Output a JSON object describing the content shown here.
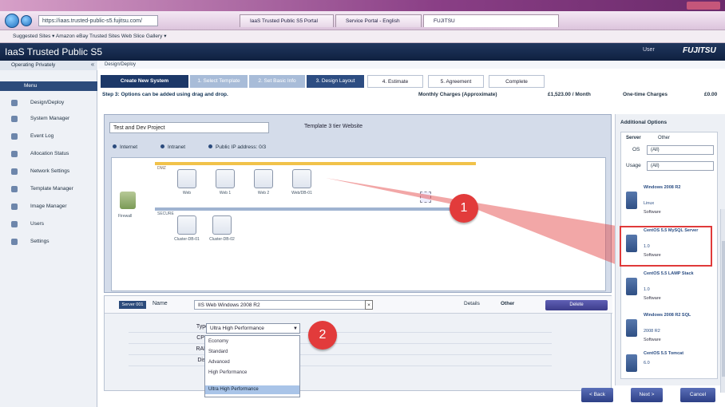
{
  "browser": {
    "url": "https://iaas.trusted-public-s5.fujitsu.com/",
    "tabs": [
      "IaaS Trusted Public S5 Portal",
      "Service Portal - English",
      "FUJITSU"
    ],
    "favorites": "Suggested Sites ▾  Amazon  eBay  Trusted Sites  Web Slice Gallery ▾"
  },
  "app": {
    "title": "IaaS Trusted Public S5",
    "user": "User",
    "logo": "FUJITSU"
  },
  "sidebar": {
    "header": "Operating Privately",
    "items": [
      {
        "label": "Menu"
      },
      {
        "label": "Design/Deploy"
      },
      {
        "label": "System Manager"
      },
      {
        "label": "Event Log"
      },
      {
        "label": "Allocation Status"
      },
      {
        "label": "Network Settings"
      },
      {
        "label": "Template Manager"
      },
      {
        "label": "Image Manager"
      },
      {
        "label": "Users"
      },
      {
        "label": "Settings"
      }
    ]
  },
  "breadcrumb": "Design/Deploy",
  "wizard": {
    "steps": [
      "Create New System",
      "1. Select Template",
      "2. Set Basic Info",
      "3. Design Layout",
      "4. Estimate",
      "5. Agreement",
      "Complete"
    ],
    "step_hint": "Step 3: Options can be added using drag and drop.",
    "monthly_label": "Monthly Charges (Approximate)",
    "monthly_value": "£1,523.00 / Month",
    "onetime_label": "One-time Charges",
    "onetime_value": "£0.00"
  },
  "canvas": {
    "system_name": "Test and Dev Project",
    "template_label": "Template 3 tier Website",
    "radio_labels": [
      "Internet",
      "Intranet",
      "Public IP address: 0/3"
    ],
    "zone1": "DMZ",
    "zone2": "SECURE",
    "firewall": "Firewall",
    "servers_dmz": [
      "Web",
      "Web 1",
      "Web 2",
      "Web/DB-01"
    ],
    "servers_secure": [
      "Cluster-DB-01",
      "Cluster-DB-02"
    ]
  },
  "properties": {
    "tag": "Server 001",
    "name_label": "Name",
    "name_value": "IIS Web Windows 2008 R2",
    "tab_details": "Details",
    "tab_other": "Other",
    "delete_label": "Delete",
    "rows": [
      "Type",
      "CPU",
      "RAM",
      "Disk"
    ],
    "type_value": "Ultra High Performance",
    "dropdown_options": [
      "Economy",
      "Standard",
      "Advanced",
      "High Performance",
      "Ultra High Performance"
    ]
  },
  "right_panel": {
    "title": "Additional Options",
    "tab_server": "Server",
    "tab_other": "Other",
    "os_label": "OS",
    "os_value": "(All)",
    "usage_label": "Usage",
    "usage_value": "(All)",
    "items": [
      {
        "name": "Windows 2008 R2",
        "sub": "Linux",
        "sw": "Software"
      },
      {
        "name": "CentOS 5.5 MySQL Server",
        "sub": "1.0",
        "sw": "Software"
      },
      {
        "name": "CentOS 5.5 LAMP Stack",
        "sub": "1.0",
        "sw": "Software"
      },
      {
        "name": "Windows 2008 R2 SQL",
        "sub": "2008 R2",
        "sw": "Software"
      },
      {
        "name": "CentOS 5.5 Tomcat",
        "sub": "6.0",
        "sw": ""
      }
    ]
  },
  "buttons": {
    "back": "< Back",
    "next": "Next >",
    "cancel": "Cancel"
  },
  "callouts": {
    "one": "1",
    "two": "2"
  },
  "colors": {
    "accent": "#2c4b7b",
    "callout": "#e23b3b",
    "dmz": "#f1c24a"
  }
}
